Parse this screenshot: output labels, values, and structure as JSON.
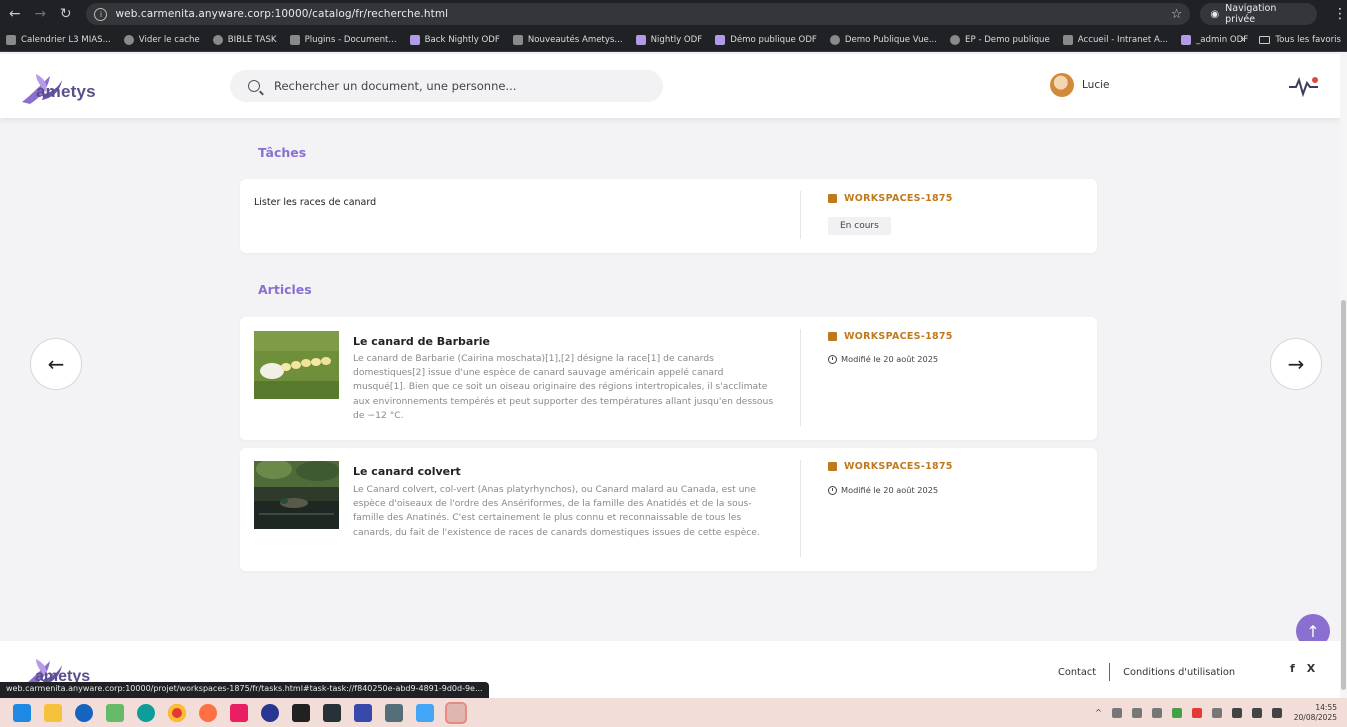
{
  "browser": {
    "back_icon": "back-arrow-icon",
    "url": "web.carmenita.anyware.corp:10000/catalog/fr/recherche.html",
    "private_label": "Navigation privée",
    "bookmarks": [
      {
        "label": "Calendrier L3 MIAS..."
      },
      {
        "label": "Vider le cache"
      },
      {
        "label": "BIBLE TASK"
      },
      {
        "label": "Plugins - Document..."
      },
      {
        "label": "Back Nightly ODF"
      },
      {
        "label": "Nouveautés Ametys..."
      },
      {
        "label": "Nightly ODF"
      },
      {
        "label": "Démo publique ODF"
      },
      {
        "label": "Demo Publique Vue..."
      },
      {
        "label": "EP - Demo publique"
      },
      {
        "label": "Accueil - Intranet A..."
      },
      {
        "label": "_admin ODF"
      }
    ],
    "more_bookmarks": "»",
    "all_bookmarks": "Tous les favoris",
    "status_url": "web.carmenita.anyware.corp:10000/projet/workspaces-1875/fr/tasks.html#task-task://f840250e-abd9-4891-9d0d-9e..."
  },
  "header": {
    "logo_text": "ametys",
    "search_placeholder": "Rechercher un document, une personne...",
    "user_name": "Lucie",
    "brand_color": "#8a6fd1"
  },
  "tasks": {
    "title": "Tâches",
    "items": [
      {
        "title": "Lister les races de canard",
        "workspace": "WORKSPACES-1875",
        "status": "En cours"
      }
    ]
  },
  "articles": {
    "title": "Articles",
    "items": [
      {
        "title": "Le canard de Barbarie",
        "description": "Le canard de Barbarie (Cairina moschata)[1],[2] désigne la race[1] de canards domestiques[2] issue d'une espèce de canard sauvage américain appelé canard musqué[1]. Bien que ce soit un oiseau originaire des régions intertropicales, il s'acclimate aux environnements tempérés et peut supporter des températures allant jusqu'en dessous de −12 °C.",
        "workspace": "WORKSPACES-1875",
        "modified": "Modifié le 20 août 2025"
      },
      {
        "title": "Le canard colvert",
        "description": "Le Canard colvert, col-vert (Anas platyrhynchos), ou Canard malard au Canada, est une espèce d'oiseaux de l'ordre des Ansériformes, de la famille des Anatidés et de la sous-famille des Anatinés. C'est certainement le plus connu et reconnaissable de tous les canards, du fait de l'existence de races de canards domestiques issues de cette espèce.",
        "workspace": "WORKSPACES-1875",
        "modified": "Modifié le 20 août 2025"
      }
    ]
  },
  "footer": {
    "logo_text": "ametys",
    "contact": "Contact",
    "terms": "Conditions d'utilisation",
    "facebook": "f",
    "x": "X"
  },
  "taskbar": {
    "time": "14:55",
    "date": "20/08/2025"
  }
}
